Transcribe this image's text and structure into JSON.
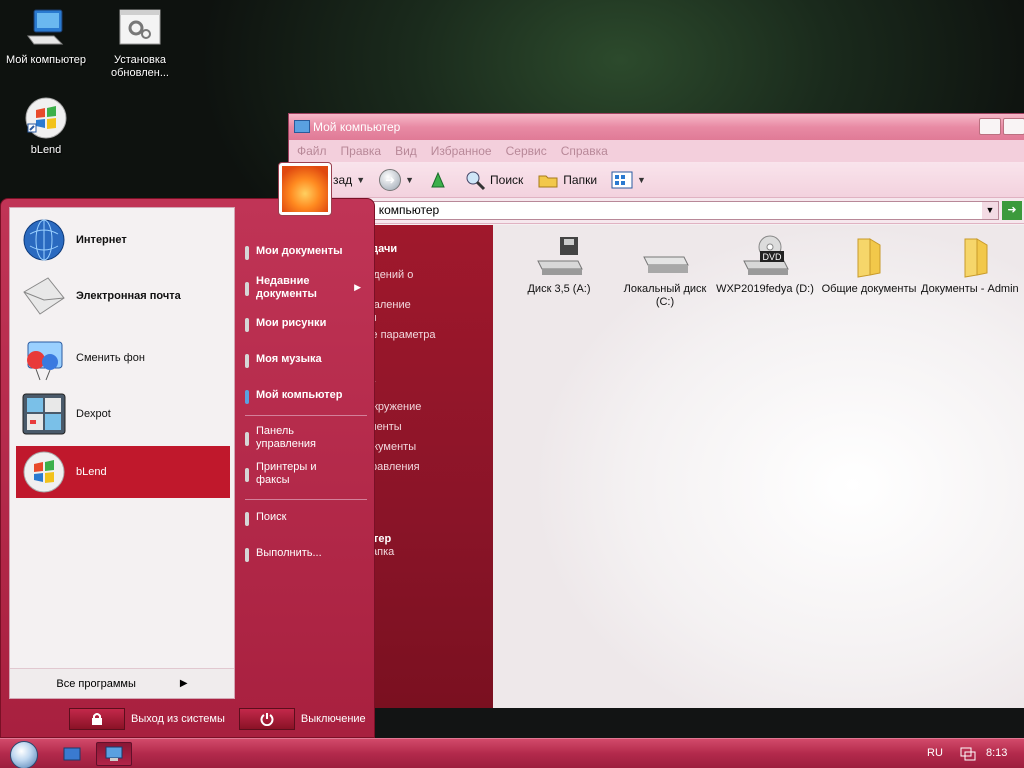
{
  "desktop": {
    "icons": [
      {
        "label": "Мой компьютер"
      },
      {
        "label": "Установка обновлен..."
      },
      {
        "label": "bLend"
      }
    ]
  },
  "window": {
    "title": "Мой компьютер",
    "menu": [
      "Файл",
      "Правка",
      "Вид",
      "Избранное",
      "Сервис",
      "Справка"
    ],
    "toolbar": {
      "back": "зад",
      "search": "Поиск",
      "folders": "Папки"
    },
    "address": "ой компьютер",
    "task_pane": {
      "heads": [
        "адачи",
        "а",
        "тер"
      ],
      "lines": [
        "р сведений о",
        "и удаление",
        "м",
        "нение параметра",
        "окружение",
        "менты",
        "окументы",
        "равления",
        "апка"
      ]
    },
    "drives": [
      {
        "label": "Диск 3,5 (A:)",
        "icon": "floppy-drive-icon"
      },
      {
        "label": "Локальный диск (C:)",
        "icon": "hard-disk-icon"
      },
      {
        "label": "WXP2019fedya (D:)",
        "icon": "dvd-drive-icon",
        "badge": "DVD"
      },
      {
        "label": "Общие документы",
        "icon": "folder-icon"
      },
      {
        "label": "Документы - Admin",
        "icon": "folder-icon"
      }
    ]
  },
  "start_menu": {
    "pinned": [
      {
        "label": "Интернет",
        "icon": "globe-icon"
      },
      {
        "label": "Электронная почта",
        "icon": "mail-envelope-icon"
      },
      {
        "label": "Сменить фон",
        "icon": "balloons-icon"
      },
      {
        "label": "Dexpot",
        "icon": "virtual-desktops-icon"
      },
      {
        "label": "bLend",
        "icon": "windows-logo-icon"
      }
    ],
    "all_programs": "Все программы",
    "right": {
      "my_docs": "Мои документы",
      "recent": "Недавние документы",
      "pictures": "Мои рисунки",
      "music": "Моя музыка",
      "computer": "Мой компьютер",
      "control_panel": "Панель управления",
      "printers": "Принтеры и факсы",
      "search": "Поиск",
      "run": "Выполнить..."
    },
    "logoff": "Выход из системы",
    "shutdown": "Выключение"
  },
  "taskbar": {
    "lang": "RU",
    "clock": "8:13"
  },
  "colors": {
    "accent": "#c0182c",
    "taskbar": "#b32a4c",
    "task_pane": "#8a1428"
  }
}
